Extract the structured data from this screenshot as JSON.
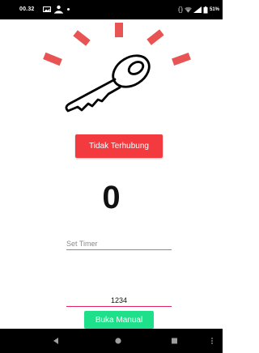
{
  "status_bar": {
    "time": "00.32",
    "battery_percent": "51%",
    "icons": [
      "image-notification-icon",
      "person-notification-icon",
      "dot-icon",
      "vibrate-icon",
      "wifi-icon",
      "signal-icon",
      "battery-icon"
    ]
  },
  "illustration": {
    "icon": "key-icon",
    "ray_color": "#e85454",
    "key_color": "#000000"
  },
  "connection": {
    "label": "Tidak Terhubung",
    "color": "#f23a3f"
  },
  "counter": {
    "value": "0"
  },
  "timer": {
    "value": "",
    "placeholder": "Set Timer"
  },
  "code": {
    "value": "1234"
  },
  "manual_open": {
    "label": "Buka Manual",
    "color": "#1fe08a"
  },
  "navigation": {
    "icons": [
      "back-icon",
      "home-icon",
      "recents-icon",
      "menu-icon"
    ]
  }
}
